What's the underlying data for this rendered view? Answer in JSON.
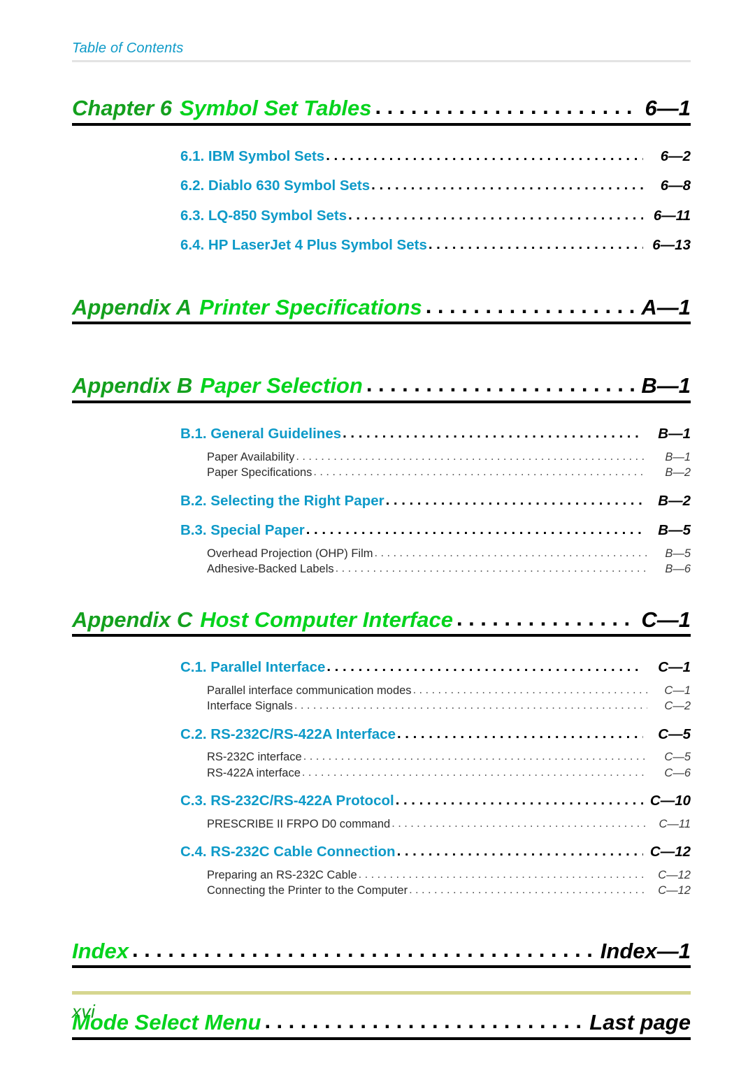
{
  "header": {
    "running_title": "Table of Contents"
  },
  "footer": {
    "page_number": "xvi"
  },
  "colors": {
    "heading_label_green": "#14a01e",
    "heading_title_green": "#05d31d",
    "section_cyan": "#0e9ac8",
    "body_text": "#2b2b2b",
    "page_number_black": "#000000",
    "header_rule": "#e3e3e3",
    "footer_rule": "#d6d68f",
    "heading_rule": "#000000"
  },
  "leader": {
    "dots": "........................................................................................."
  },
  "entries": [
    {
      "level": 1,
      "label": "Chapter 6",
      "title": "Symbol Set Tables",
      "page": "6—1"
    },
    {
      "level": 2,
      "title": "6.1. IBM Symbol Sets",
      "page": "6—2"
    },
    {
      "level": 2,
      "title": "6.2. Diablo 630 Symbol Sets",
      "page": "6—8"
    },
    {
      "level": 2,
      "title": "6.3. LQ-850 Symbol Sets",
      "page": "6—11"
    },
    {
      "level": 2,
      "title": "6.4. HP LaserJet 4 Plus Symbol Sets",
      "page": "6—13"
    },
    {
      "level": 1,
      "label": "Appendix A",
      "title": "Printer Specifications",
      "page": "A—1"
    },
    {
      "level": 1,
      "label": "Appendix B",
      "title": "Paper Selection",
      "page": "B—1"
    },
    {
      "level": 2,
      "title": "B.1. General Guidelines",
      "page": "B—1"
    },
    {
      "level": 3,
      "title": "Paper Availability",
      "page": "B—1"
    },
    {
      "level": 3,
      "title": "Paper Specifications",
      "page": "B—2"
    },
    {
      "level": 2,
      "title": "B.2. Selecting the Right Paper",
      "page": "B—2"
    },
    {
      "level": 2,
      "title": "B.3. Special Paper",
      "page": "B—5"
    },
    {
      "level": 3,
      "title": "Overhead Projection (OHP) Film",
      "page": "B—5"
    },
    {
      "level": 3,
      "title": "Adhesive-Backed Labels",
      "page": "B—6"
    },
    {
      "level": 1,
      "label": "Appendix C",
      "title": "Host Computer Interface",
      "page": "C—1"
    },
    {
      "level": 2,
      "title": "C.1. Parallel Interface",
      "page": "C—1"
    },
    {
      "level": 3,
      "title": "Parallel interface communication modes",
      "page": "C—1"
    },
    {
      "level": 3,
      "title": "Interface Signals",
      "page": "C—2"
    },
    {
      "level": 2,
      "title": "C.2. RS-232C/RS-422A Interface",
      "page": "C—5"
    },
    {
      "level": 3,
      "title": "RS-232C interface",
      "page": "C—5"
    },
    {
      "level": 3,
      "title": "RS-422A interface",
      "page": "C—6"
    },
    {
      "level": 2,
      "title": "C.3. RS-232C/RS-422A Protocol",
      "page": "C—10"
    },
    {
      "level": 3,
      "title": "PRESCRIBE II FRPO D0 command",
      "page": "C—11"
    },
    {
      "level": 2,
      "title": "C.4. RS-232C Cable Connection",
      "page": "C—12"
    },
    {
      "level": 3,
      "title": "Preparing an RS-232C Cable",
      "page": "C—12"
    },
    {
      "level": 3,
      "title": "Connecting the Printer to the Computer",
      "page": "C—12"
    },
    {
      "level": 1,
      "label": "",
      "title": "Index",
      "page": "Index—1"
    },
    {
      "level": 1,
      "label": "",
      "title": "Mode Select Menu",
      "page": "Last page"
    }
  ]
}
